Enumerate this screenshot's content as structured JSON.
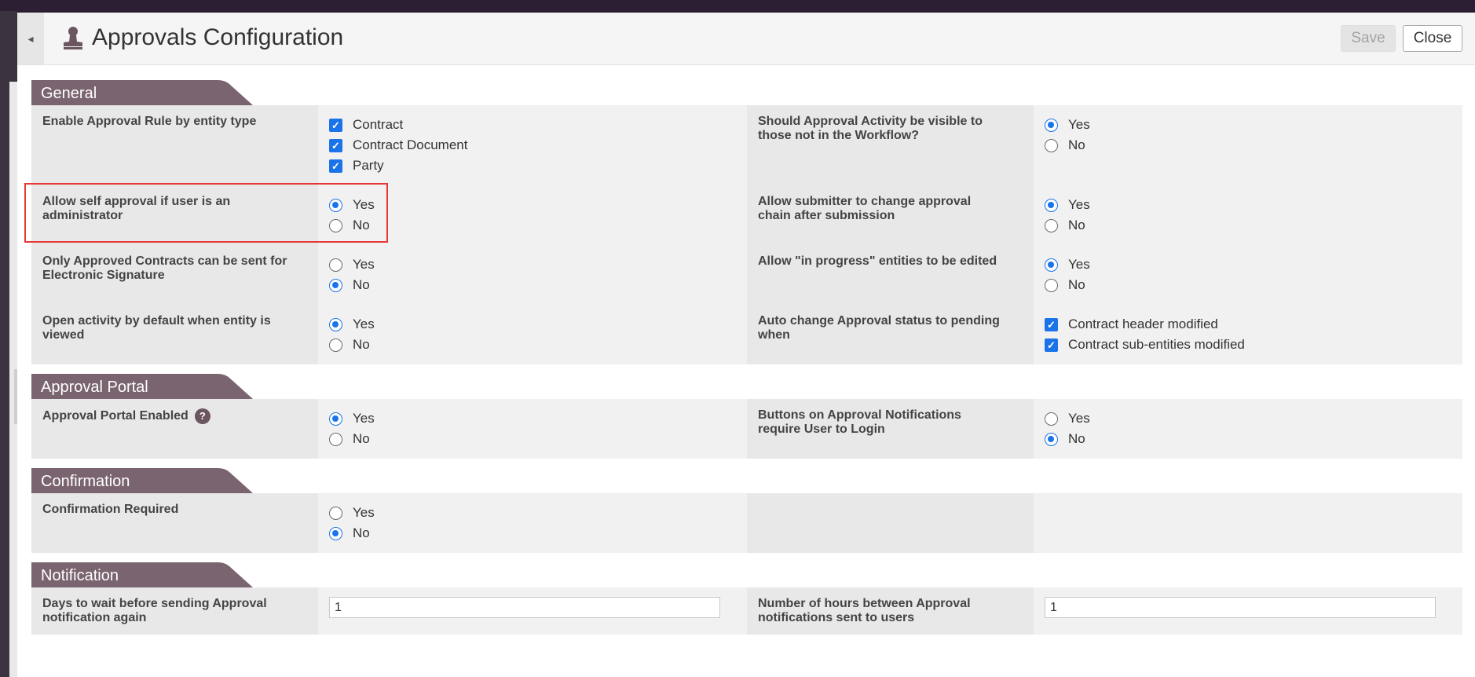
{
  "header": {
    "title": "Approvals Configuration",
    "save_label": "Save",
    "close_label": "Close",
    "icon": "user-stamp-icon"
  },
  "colors": {
    "section_tab": "#7a6470",
    "accent_blue": "#1a73e8",
    "highlight_box": "#e53935"
  },
  "sections": {
    "general": {
      "title": "General",
      "rows": [
        {
          "left_label": "Enable Approval Rule by entity type",
          "left_options": [
            "Contract",
            "Contract Document",
            "Party"
          ],
          "left_checked": [
            true,
            true,
            true
          ],
          "right_label": "Should Approval Activity be visible to those not in the Workflow?",
          "right_options": [
            "Yes",
            "No"
          ],
          "right_selected": "Yes"
        },
        {
          "left_label": "Allow self approval if user is an administrator",
          "left_options": [
            "Yes",
            "No"
          ],
          "left_selected": "Yes",
          "right_label": "Allow submitter to change approval chain after submission",
          "right_options": [
            "Yes",
            "No"
          ],
          "right_selected": "Yes"
        },
        {
          "left_label": "Only Approved Contracts can be sent for Electronic Signature",
          "left_options": [
            "Yes",
            "No"
          ],
          "left_selected": "No",
          "right_label": "Allow \"in progress\" entities to be edited",
          "right_options": [
            "Yes",
            "No"
          ],
          "right_selected": "Yes"
        },
        {
          "left_label": "Open activity by default when entity is viewed",
          "left_options": [
            "Yes",
            "No"
          ],
          "left_selected": "Yes",
          "right_label": "Auto change Approval status to pending when",
          "right_options": [
            "Contract header modified",
            "Contract sub-entities modified"
          ],
          "right_checked": [
            true,
            true
          ]
        }
      ]
    },
    "approval_portal": {
      "title": "Approval Portal",
      "rows": [
        {
          "left_label": "Approval Portal Enabled",
          "left_help": "?",
          "left_options": [
            "Yes",
            "No"
          ],
          "left_selected": "Yes",
          "right_label": "Buttons on Approval Notifications require User to Login",
          "right_options": [
            "Yes",
            "No"
          ],
          "right_selected": "No"
        }
      ]
    },
    "confirmation": {
      "title": "Confirmation",
      "rows": [
        {
          "left_label": "Confirmation Required",
          "left_options": [
            "Yes",
            "No"
          ],
          "left_selected": "No"
        }
      ]
    },
    "notification": {
      "title": "Notification",
      "rows": [
        {
          "left_label": "Days to wait before sending Approval notification again",
          "left_value": "1",
          "right_label": "Number of hours between Approval notifications sent to users",
          "right_value": "1"
        }
      ]
    }
  }
}
